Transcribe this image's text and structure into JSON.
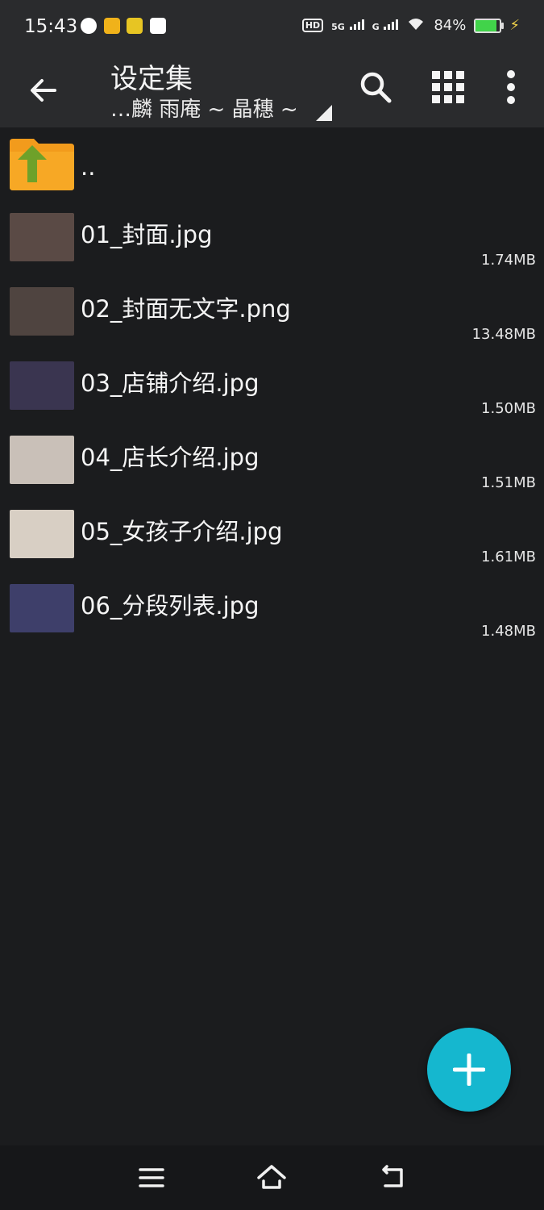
{
  "status_bar": {
    "time": "15:43",
    "hd": "HD",
    "signal1": "5G",
    "signal2": "G",
    "battery": "84%",
    "colors": {
      "app1": "#f7d23a",
      "app2": "#f0b21a",
      "app3": "#e7c523",
      "app4": "#ffffff",
      "battery": "#41d34a"
    }
  },
  "toolbar": {
    "title": "设定集",
    "subtitle": "…麟 雨庵 ~ 晶穗 ~",
    "icons": [
      "back-arrow-icon",
      "search-icon",
      "grid-view-icon",
      "more-vert-icon",
      "dropdown-triangle-icon"
    ]
  },
  "files": {
    "parent": {
      "name": ".."
    },
    "items": [
      {
        "name": "01_封面.jpg",
        "size": "1.74MB",
        "thumb_color": "#5a4a45"
      },
      {
        "name": "02_封面无文字.png",
        "size": "13.48MB",
        "thumb_color": "#4f4440"
      },
      {
        "name": "03_店铺介绍.jpg",
        "size": "1.50MB",
        "thumb_color": "#3a3550"
      },
      {
        "name": "04_店长介绍.jpg",
        "size": "1.51MB",
        "thumb_color": "#c9c0b8"
      },
      {
        "name": "05_女孩子介绍.jpg",
        "size": "1.61MB",
        "thumb_color": "#d8cfc4"
      },
      {
        "name": "06_分段列表.jpg",
        "size": "1.48MB",
        "thumb_color": "#3e3f6a"
      }
    ]
  },
  "fab": {
    "icon": "plus-icon",
    "color": "#15b7cf"
  },
  "nav": {
    "icons": [
      "menu-icon",
      "home-icon",
      "back-icon"
    ]
  }
}
